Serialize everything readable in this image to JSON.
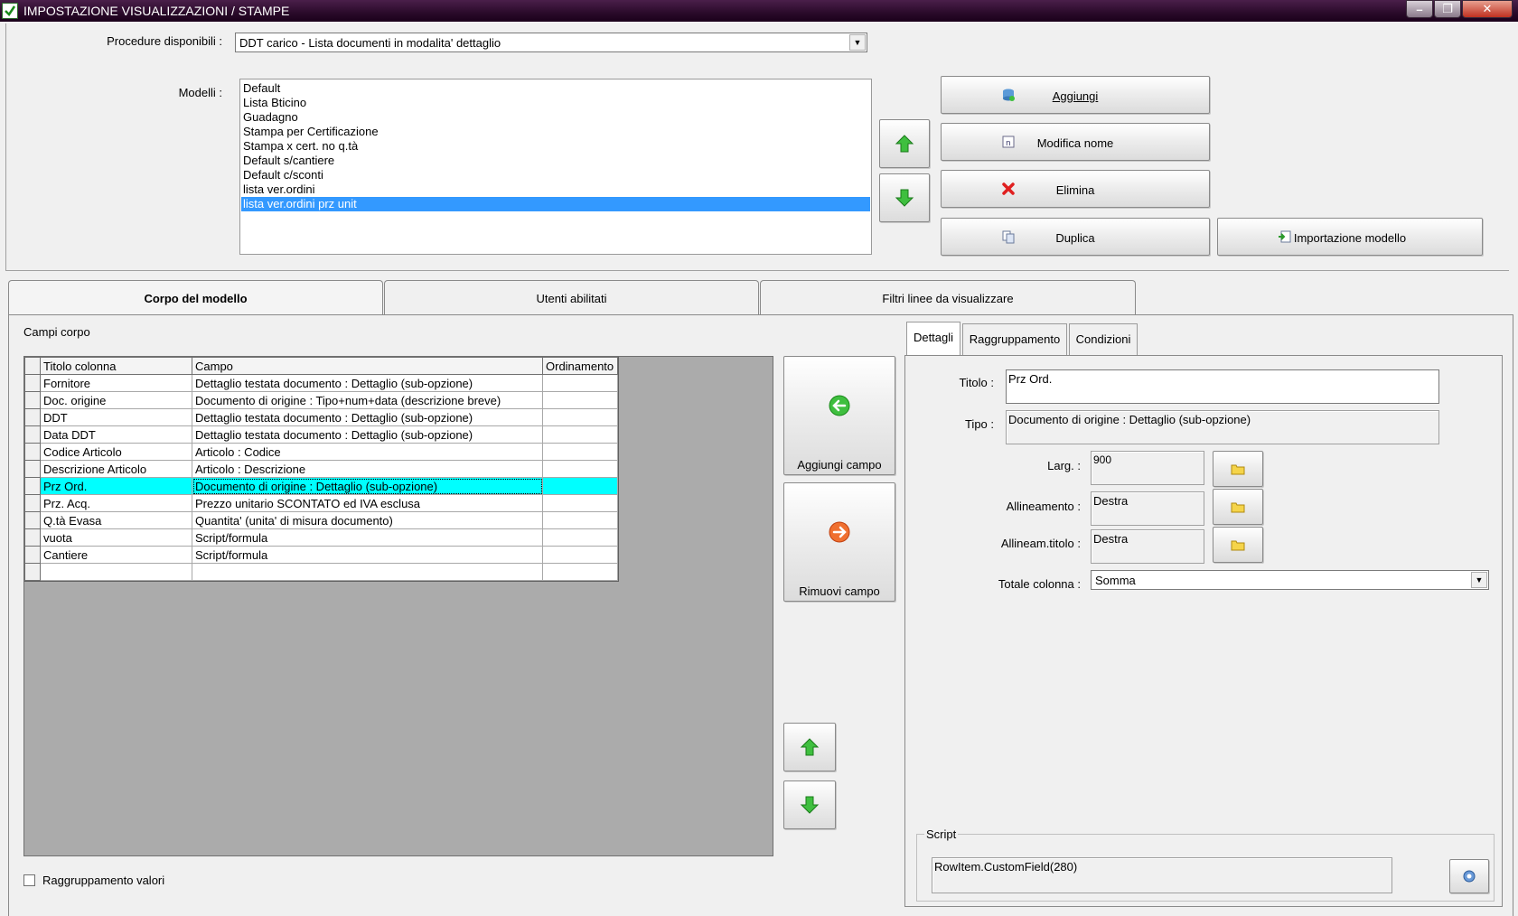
{
  "window": {
    "title": "IMPOSTAZIONE VISUALIZZAZIONI / STAMPE",
    "controls": {
      "minimize": "–",
      "restore": "❐",
      "close": "✕"
    }
  },
  "procedures": {
    "label": "Procedure disponibili :",
    "selected": "DDT carico - Lista documenti in modalita' dettaglio"
  },
  "models": {
    "label": "Modelli :",
    "items": [
      "Default",
      "Lista Bticino",
      "Guadagno",
      "Stampa per Certificazione",
      "Stampa x cert. no q.tà",
      "Default s/cantiere",
      "Default c/sconti",
      "lista ver.ordini",
      "lista ver.ordini prz unit"
    ],
    "selected_index": 8
  },
  "model_buttons": {
    "add": "Aggiungi",
    "rename": "Modifica nome",
    "delete": "Elimina",
    "duplicate": "Duplica",
    "import": "Importazione modello"
  },
  "tabs": [
    "Corpo del modello",
    "Utenti abilitati",
    "Filtri linee da visualizzare"
  ],
  "body": {
    "section_label": "Campi corpo",
    "columns": [
      "Titolo colonna",
      "Campo",
      "Ordinamento"
    ],
    "rows": [
      [
        "Fornitore",
        "Dettaglio testata documento : Dettaglio (sub-opzione)",
        ""
      ],
      [
        "Doc. origine",
        "Documento di origine : Tipo+num+data (descrizione breve)",
        ""
      ],
      [
        "DDT",
        "Dettaglio testata documento : Dettaglio (sub-opzione)",
        ""
      ],
      [
        "Data DDT",
        "Dettaglio testata documento : Dettaglio (sub-opzione)",
        ""
      ],
      [
        "Codice Articolo",
        "Articolo : Codice",
        ""
      ],
      [
        "Descrizione Articolo",
        "Articolo : Descrizione",
        ""
      ],
      [
        "Prz Ord.",
        "Documento di origine : Dettaglio (sub-opzione)",
        ""
      ],
      [
        "Prz. Acq.",
        "Prezzo unitario SCONTATO ed IVA esclusa",
        ""
      ],
      [
        "Q.tà Evasa",
        "Quantita' (unita' di misura documento)",
        ""
      ],
      [
        "vuota",
        "Script/formula",
        ""
      ],
      [
        "Cantiere",
        "Script/formula",
        ""
      ],
      [
        "",
        "",
        ""
      ]
    ],
    "selected_row": 6,
    "add_field": "Aggiungi campo",
    "remove_field": "Rimuovi campo",
    "grouping_checkbox": "Raggruppamento valori"
  },
  "detail": {
    "subtabs": [
      "Dettagli",
      "Raggruppamento",
      "Condizioni"
    ],
    "title_label": "Titolo :",
    "title_value": "Prz Ord.",
    "type_label": "Tipo :",
    "type_value": "Documento di origine : Dettaglio (sub-opzione)",
    "width_label": "Larg. :",
    "width_value": "900",
    "align_label": "Allineamento :",
    "align_value": "Destra",
    "title_align_label": "Allineam.titolo :",
    "title_align_value": "Destra",
    "total_label": "Totale colonna :",
    "total_value": "Somma",
    "script_legend": "Script",
    "script_value": "RowItem.CustomField(280)"
  },
  "colors": {
    "list_selection": "#3399ff",
    "row_selection": "#00ffff",
    "grid_background": "#ababab",
    "arrow_green": "#3aa83a"
  }
}
